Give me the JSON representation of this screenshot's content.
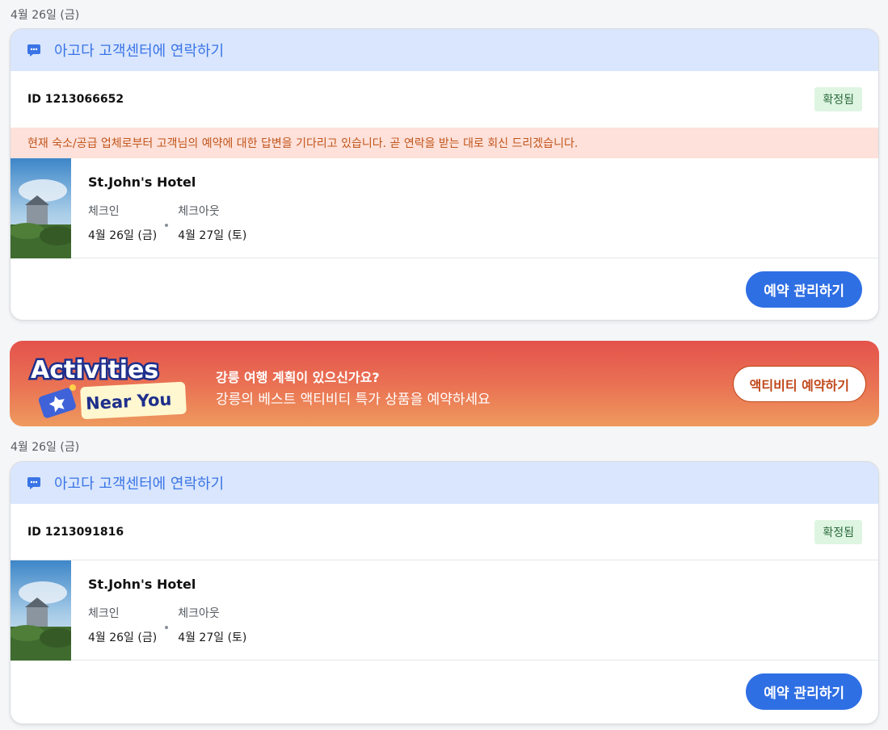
{
  "bookings": [
    {
      "date_label": "4월 26일 (금)",
      "contact_link": "아고다 고객센터에 연락하기",
      "id_text": "ID 1213066652",
      "status": "확정됨",
      "notice": "현재 숙소/공급 업체로부터 고객님의 예약에 대한 답변을 기다리고 있습니다. 곧 연락을 받는 대로 회신 드리겠습니다.",
      "hotel_name": "St.John's Hotel",
      "checkin_label": "체크인",
      "checkin_date": "4월 26일 (금)",
      "checkout_label": "체크아웃",
      "checkout_date": "4월 27일 (토)",
      "manage_button": "예약 관리하기"
    },
    {
      "date_label": "4월 26일 (금)",
      "contact_link": "아고다 고객센터에 연락하기",
      "id_text": "ID 1213091816",
      "status": "확정됨",
      "hotel_name": "St.John's Hotel",
      "checkin_label": "체크인",
      "checkin_date": "4월 26일 (금)",
      "checkout_label": "체크아웃",
      "checkout_date": "4월 27일 (토)",
      "manage_button": "예약 관리하기"
    }
  ],
  "banner": {
    "logo_line1": "Activities",
    "logo_line2": "Near You",
    "title": "강릉 여행 계획이 있으신가요?",
    "subtitle": "강릉의 베스트 액티비티 특가 상품을 예약하세요",
    "button": "액티비티 예약하기"
  },
  "colors": {
    "accent": "#2f6fe4",
    "header_bg": "#d9e6fd",
    "status_bg": "#def5e2",
    "notice_bg": "#fde1da",
    "notice_text": "#c2551b"
  },
  "icons": {
    "contact": "chat-bubble-icon",
    "thumbnail": "hotel-thumbnail"
  }
}
